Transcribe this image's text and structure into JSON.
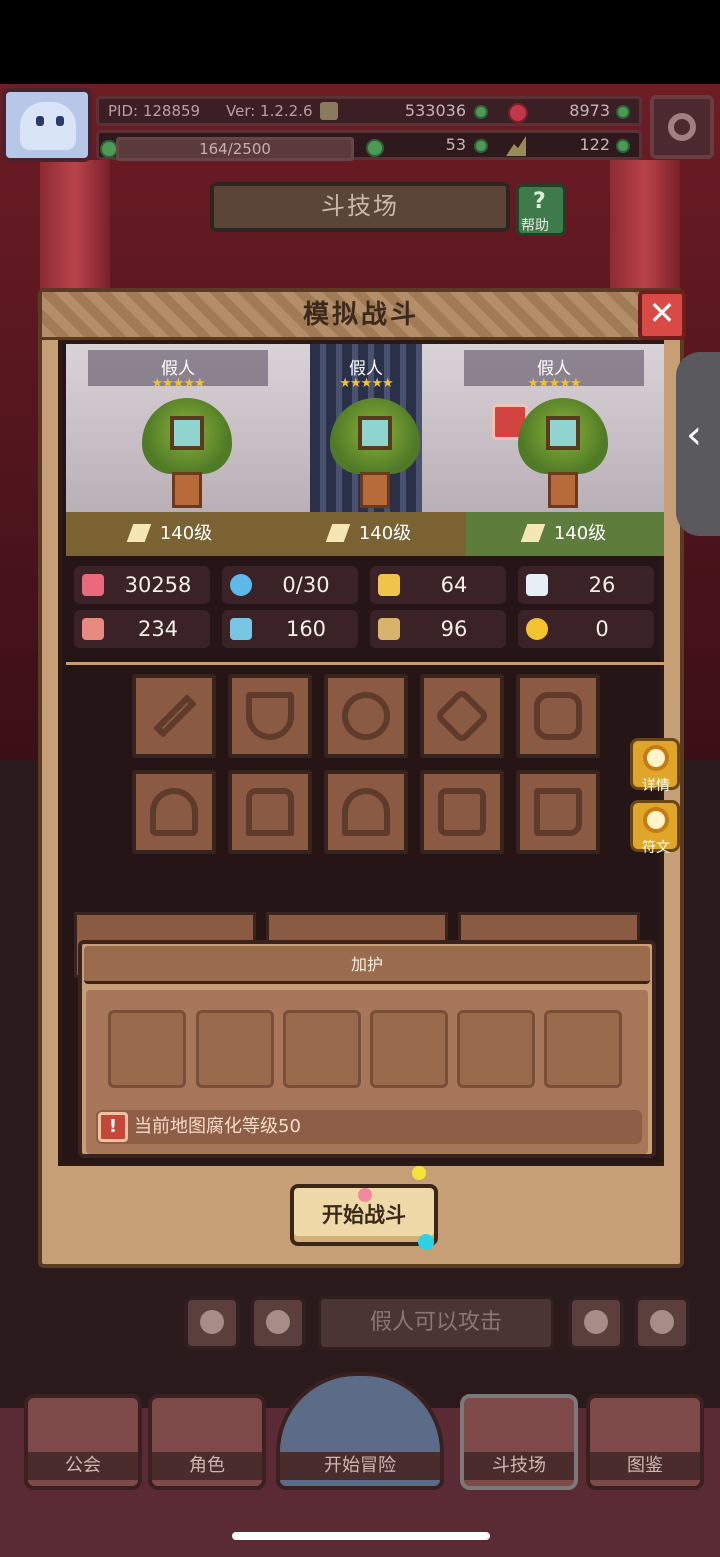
{
  "header": {
    "pid": "PID: 128859",
    "version": "Ver: 1.2.2.6",
    "gold": "533036",
    "gems": "8973",
    "xp": "164/2500",
    "clover": "53",
    "trophy": "122"
  },
  "arena": {
    "title": "斗技场",
    "help_label": "帮助"
  },
  "dialog": {
    "title": "模拟战斗",
    "fighters": [
      {
        "name": "假人",
        "stars": "★★★★★",
        "level": "140级"
      },
      {
        "name": "假人",
        "stars": "★★★★★",
        "level": "140级"
      },
      {
        "name": "假人",
        "stars": "★★★★★",
        "level": "140级"
      }
    ],
    "stats": {
      "hp": "30258",
      "mana": "0/30",
      "armor": "64",
      "speed": "26",
      "attack": "234",
      "magic": "160",
      "crit": "96",
      "luck": "0"
    },
    "side_buttons": {
      "details": "详情",
      "rune": "符文"
    },
    "guard": {
      "header": "加护",
      "warning": "当前地图腐化等级50"
    },
    "start_button": "开始战斗"
  },
  "toolbar": {
    "hint": "假人可以攻击"
  },
  "dock": {
    "guild": "公会",
    "character": "角色",
    "adventure": "开始冒险",
    "arena": "斗技场",
    "codex": "图鉴"
  },
  "colors": {
    "dialog_bg": "#c69f76",
    "accent_gold": "#e0a62a",
    "close_red": "#d84a45",
    "selected_level": "#5e7d3c"
  }
}
